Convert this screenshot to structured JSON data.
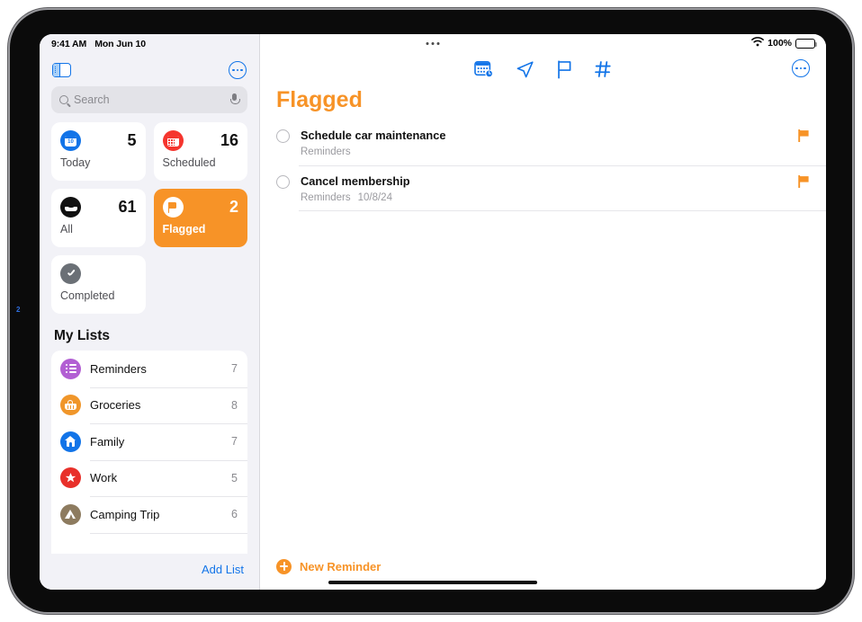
{
  "status_bar": {
    "time": "9:41 AM",
    "date": "Mon Jun 10",
    "battery_percent": "100%",
    "wifi_icon": "wifi-icon",
    "battery_icon": "battery-icon",
    "menu_dots_icon": "multitask-dots-icon"
  },
  "sidebar": {
    "toggle_icon": "sidebar-toggle-icon",
    "more_icon": "more-ellipsis-icon",
    "search": {
      "placeholder": "Search",
      "value": "",
      "search_icon": "search-icon",
      "mic_icon": "microphone-icon"
    },
    "smart_lists": [
      {
        "label": "Today",
        "count": "5",
        "icon": "today-calendar-icon",
        "day": "10",
        "selected": false
      },
      {
        "label": "Scheduled",
        "count": "16",
        "icon": "scheduled-calendar-icon",
        "selected": false
      },
      {
        "label": "All",
        "count": "61",
        "icon": "all-inbox-icon",
        "selected": false
      },
      {
        "label": "Flagged",
        "count": "2",
        "icon": "flag-icon",
        "selected": true
      },
      {
        "label": "Completed",
        "count": "",
        "icon": "check-circle-icon",
        "selected": false
      }
    ],
    "my_lists_header": "My Lists",
    "lists": [
      {
        "name": "Reminders",
        "count": "7",
        "icon": "list-bullets-icon",
        "color": "#b25fd3"
      },
      {
        "name": "Groceries",
        "count": "8",
        "icon": "basket-icon",
        "color": "#f0962a"
      },
      {
        "name": "Family",
        "count": "7",
        "icon": "house-icon",
        "color": "#1274e8"
      },
      {
        "name": "Work",
        "count": "5",
        "icon": "star-icon",
        "color": "#e8302a"
      },
      {
        "name": "Camping Trip",
        "count": "6",
        "icon": "tent-icon",
        "color": "#8d7b5f"
      }
    ],
    "add_list_label": "Add List"
  },
  "detail": {
    "title": "Flagged",
    "title_color": "#f79327",
    "toolbar_icons": [
      "calendar-clock-icon",
      "location-arrow-icon",
      "flag-icon",
      "hashtag-icon"
    ],
    "more_icon": "more-ellipsis-icon",
    "reminders": [
      {
        "title": "Schedule car maintenance",
        "list": "Reminders",
        "date": "",
        "flagged": true,
        "completed": false
      },
      {
        "title": "Cancel membership",
        "list": "Reminders",
        "date": "10/8/24",
        "flagged": true,
        "completed": false
      }
    ],
    "new_reminder_label": "New Reminder",
    "new_reminder_icon": "plus-circle-icon"
  },
  "annotation": {
    "marker": "2"
  }
}
